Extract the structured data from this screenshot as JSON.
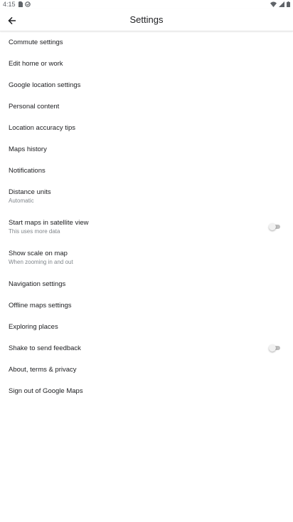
{
  "status_bar": {
    "time": "4:15",
    "left_icons": [
      "sim-card-icon",
      "notification-icon"
    ],
    "right_icons": [
      "wifi-icon",
      "signal-icon",
      "battery-icon"
    ]
  },
  "app_bar": {
    "title": "Settings",
    "back_icon": "arrow-back-icon"
  },
  "settings": [
    {
      "label": "Commute settings"
    },
    {
      "label": "Edit home or work"
    },
    {
      "label": "Google location settings"
    },
    {
      "label": "Personal content"
    },
    {
      "label": "Location accuracy tips"
    },
    {
      "label": "Maps history"
    },
    {
      "label": "Notifications"
    },
    {
      "label": "Distance units",
      "subtitle": "Automatic"
    },
    {
      "label": "Start maps in satellite view",
      "subtitle": "This uses more data",
      "toggle": false
    },
    {
      "label": "Show scale on map",
      "subtitle": "When zooming in and out"
    },
    {
      "label": "Navigation settings"
    },
    {
      "label": "Offline maps settings"
    },
    {
      "label": "Exploring places"
    },
    {
      "label": "Shake to send feedback",
      "toggle": false
    },
    {
      "label": "About, terms & privacy"
    },
    {
      "label": "Sign out of Google Maps"
    }
  ],
  "colors": {
    "text_primary": "#202124",
    "text_secondary": "#80868b",
    "toggle_off_track": "#bdbdbd",
    "toggle_off_thumb": "#f1f1f1"
  }
}
